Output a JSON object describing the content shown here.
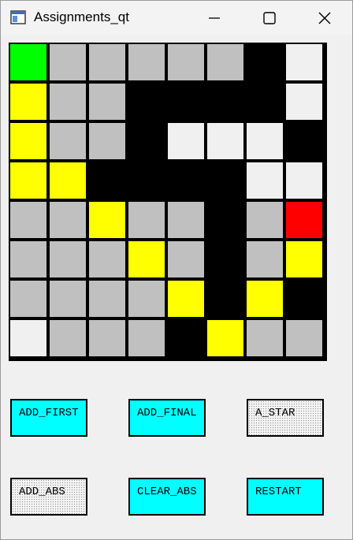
{
  "window": {
    "title": "Assignments_qt"
  },
  "grid": {
    "rows": 8,
    "cols": 8,
    "legend_colors": {
      "start": "#00ff00",
      "goal": "#ff0000",
      "path": "#ffff00",
      "wall": "#000000",
      "free": "#c0c0c0",
      "open": "#f0f0f0"
    },
    "cells": [
      [
        "start",
        "free",
        "free",
        "free",
        "free",
        "free",
        "wall",
        "open"
      ],
      [
        "path",
        "free",
        "free",
        "wall",
        "wall",
        "wall",
        "wall",
        "open"
      ],
      [
        "path",
        "free",
        "free",
        "wall",
        "open",
        "open",
        "open",
        "wall"
      ],
      [
        "path",
        "path",
        "wall",
        "wall",
        "wall",
        "wall",
        "open",
        "open"
      ],
      [
        "free",
        "free",
        "path",
        "free",
        "free",
        "wall",
        "free",
        "goal"
      ],
      [
        "free",
        "free",
        "free",
        "path",
        "free",
        "wall",
        "free",
        "path"
      ],
      [
        "free",
        "free",
        "free",
        "free",
        "path",
        "wall",
        "path",
        "wall"
      ],
      [
        "open",
        "free",
        "free",
        "free",
        "wall",
        "path",
        "free",
        "free"
      ]
    ]
  },
  "buttons": {
    "add_first": "ADD_FIRST",
    "add_final": "ADD_FINAL",
    "a_star": "A_STAR",
    "add_abs": "ADD_ABS",
    "clear_abs": "CLEAR_ABS",
    "restart": "RESTART"
  }
}
